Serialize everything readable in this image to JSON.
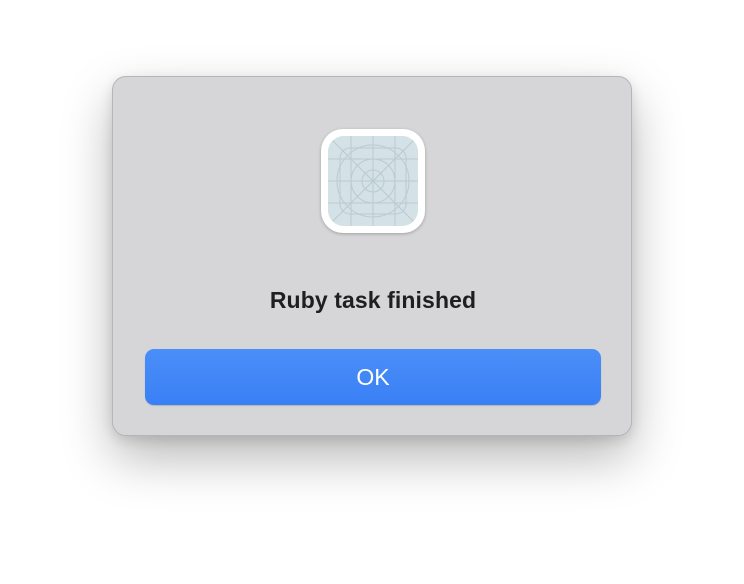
{
  "dialog": {
    "title": "Ruby task finished",
    "ok_label": "OK",
    "icon": "app-placeholder-icon"
  },
  "colors": {
    "dialog_background": "#d6d5d8",
    "button_background": "#3f85f6",
    "button_text": "#ffffff",
    "title_text": "#1f1f1f",
    "icon_fill": "#d4e1e6",
    "icon_lines": "#b7c9d0"
  }
}
